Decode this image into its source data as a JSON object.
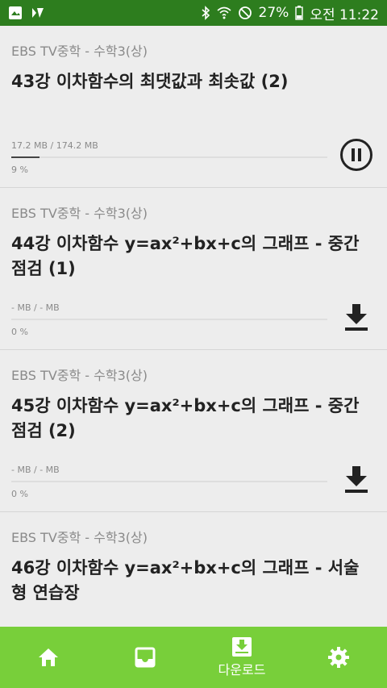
{
  "status_bar": {
    "battery_percent": "27%",
    "time": "오전 11:22",
    "icons": [
      "photo-notification-icon",
      "app-notification-icon",
      "bluetooth-icon",
      "wifi-icon",
      "do-not-disturb-icon",
      "battery-icon"
    ]
  },
  "downloads": [
    {
      "course": "EBS TV중학 - 수학3(상)",
      "title": "43강 이차함수의 최댓값과 최솟값 (2)",
      "size": "17.2 MB / 174.2 MB",
      "progress_label": "9 %",
      "progress": 0.09,
      "action": "pause-icon"
    },
    {
      "course": "EBS TV중학 - 수학3(상)",
      "title": "44강 이차함수 y=ax²+bx+c의 그래프 - 중간점검 (1)",
      "size": "- MB / - MB",
      "progress_label": "0 %",
      "progress": 0,
      "action": "download-icon"
    },
    {
      "course": "EBS TV중학 - 수학3(상)",
      "title": "45강 이차함수 y=ax²+bx+c의 그래프 - 중간점검 (2)",
      "size": "- MB / - MB",
      "progress_label": "0 %",
      "progress": 0,
      "action": "download-icon"
    },
    {
      "course": "EBS TV중학 - 수학3(상)",
      "title": "46강 이차함수 y=ax²+bx+c의 그래프 - 서술형 연습장"
    }
  ],
  "bottom_nav": {
    "items": [
      {
        "icon": "home-icon",
        "label": ""
      },
      {
        "icon": "inbox-icon",
        "label": ""
      },
      {
        "icon": "download-box-icon",
        "label": "다운로드"
      },
      {
        "icon": "settings-gear-icon",
        "label": ""
      }
    ]
  },
  "colors": {
    "status_bar": "#2d7d1e",
    "bottom_nav": "#78cf3a",
    "background": "#ededed"
  }
}
